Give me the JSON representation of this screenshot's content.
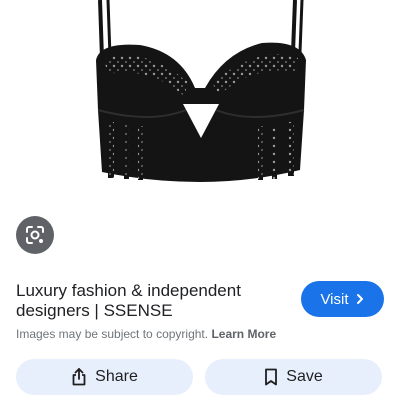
{
  "result": {
    "title": "Luxury fashion & independent designers | SSENSE",
    "visit_label": "Visit",
    "copyright_text": "Images may be subject to copyright.",
    "learn_more_label": "Learn More"
  },
  "actions": {
    "share_label": "Share",
    "save_label": "Save"
  },
  "icons": {
    "lens": "google-lens-icon",
    "visit": "chevron-right-icon",
    "share": "share-icon",
    "save": "bookmark-icon"
  },
  "colors": {
    "visit_bg": "#1a73e8",
    "pill_bg": "#e8effc",
    "lens_bg": "#5f6368"
  }
}
